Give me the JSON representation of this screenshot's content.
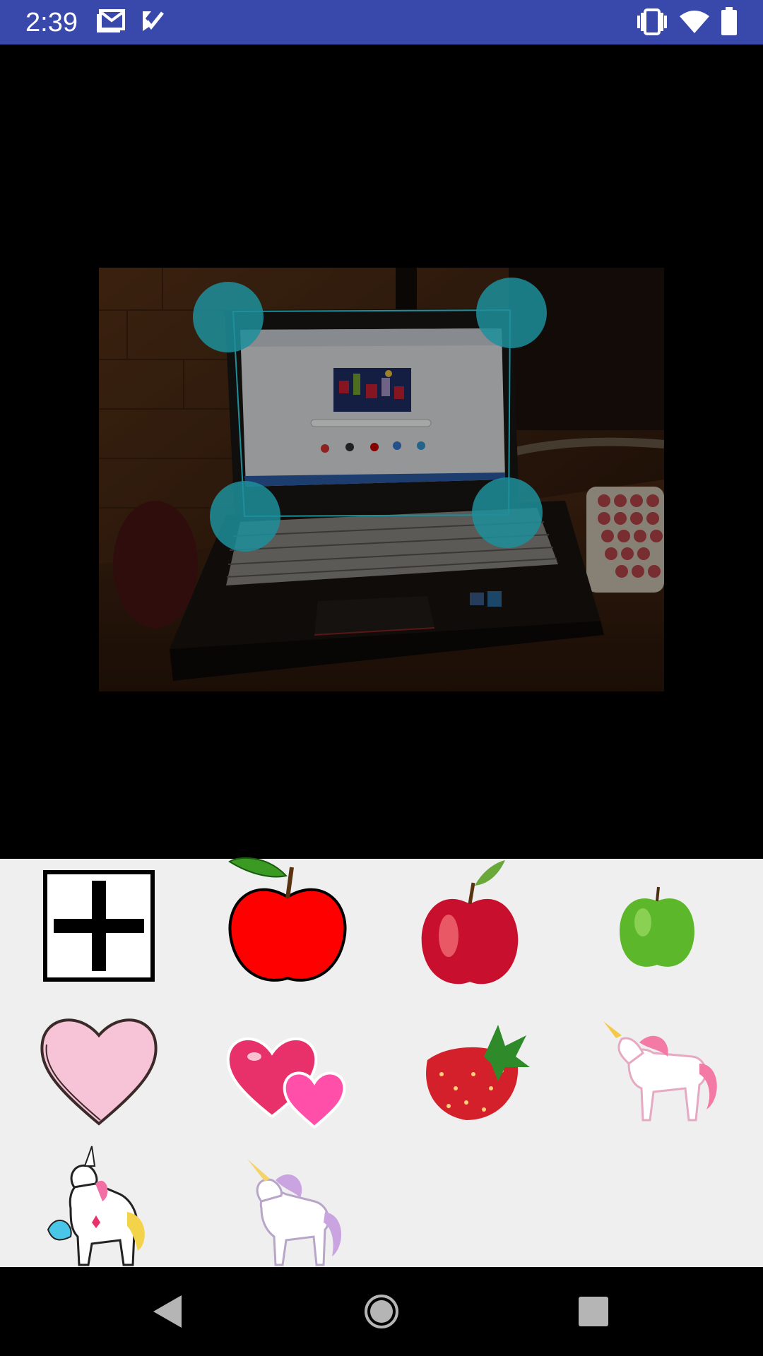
{
  "status_bar": {
    "time": "2:39",
    "notification_icons": [
      "gmail-icon",
      "tasks-check-icon"
    ],
    "system_icons": [
      "vibrate-icon",
      "wifi-icon",
      "battery-icon"
    ],
    "background_color": "#3948ab"
  },
  "editor": {
    "photo_description_icon": "laptop-photo",
    "crop_handles": [
      "top-left",
      "top-right",
      "bottom-left",
      "bottom-right"
    ],
    "handle_color": "#1d8f9b"
  },
  "stickers": {
    "items": [
      {
        "name": "add-sticker-button",
        "icon": "plus-icon"
      },
      {
        "name": "sticker-red-apple-cartoon",
        "icon": "red-apple-cartoon"
      },
      {
        "name": "sticker-red-apple-glossy",
        "icon": "red-apple-glossy"
      },
      {
        "name": "sticker-green-apple",
        "icon": "green-apple"
      },
      {
        "name": "sticker-pink-heart",
        "icon": "pink-heart"
      },
      {
        "name": "sticker-two-hearts",
        "icon": "two-hearts"
      },
      {
        "name": "sticker-strawberry",
        "icon": "strawberry"
      },
      {
        "name": "sticker-pink-unicorn",
        "icon": "pink-unicorn"
      },
      {
        "name": "sticker-rainbow-unicorn",
        "icon": "rainbow-unicorn"
      },
      {
        "name": "sticker-lilac-unicorn",
        "icon": "lilac-unicorn"
      }
    ]
  },
  "nav_bar": {
    "buttons": [
      "back-icon",
      "home-icon",
      "recents-icon"
    ]
  }
}
